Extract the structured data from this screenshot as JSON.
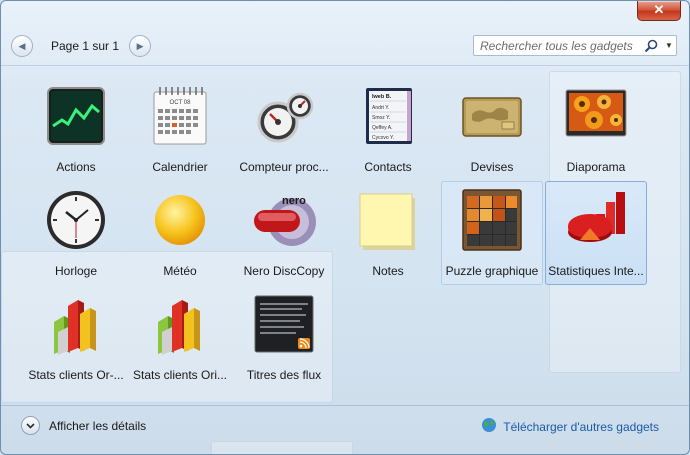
{
  "window": {
    "close_label": "✕"
  },
  "pager": {
    "label": "Page 1 sur 1"
  },
  "search": {
    "placeholder": "Rechercher tous les gadgets"
  },
  "gadgets": [
    {
      "label": "Actions"
    },
    {
      "label": "Calendrier"
    },
    {
      "label": "Compteur proc..."
    },
    {
      "label": "Contacts"
    },
    {
      "label": "Devises"
    },
    {
      "label": "Diaporama"
    },
    {
      "label": "Horloge"
    },
    {
      "label": "Météo"
    },
    {
      "label": "Nero DiscCopy"
    },
    {
      "label": "Notes"
    },
    {
      "label": "Puzzle graphique"
    },
    {
      "label": "Statistiques Inte..."
    },
    {
      "label": "Stats clients Or-..."
    },
    {
      "label": "Stats clients Ori..."
    },
    {
      "label": "Titres des flux"
    }
  ],
  "calendar_icon": {
    "month": "OCT 08"
  },
  "contacts_icon": {
    "names": [
      "Iweb B.",
      "Andrt Y.",
      "Smoz Y.",
      "Qeffey A.",
      "Cycovo Y."
    ]
  },
  "nero_icon": {
    "brand": "nero"
  },
  "footer": {
    "details_label": "Afficher les détails",
    "download_label": "Télécharger d'autres gadgets"
  }
}
